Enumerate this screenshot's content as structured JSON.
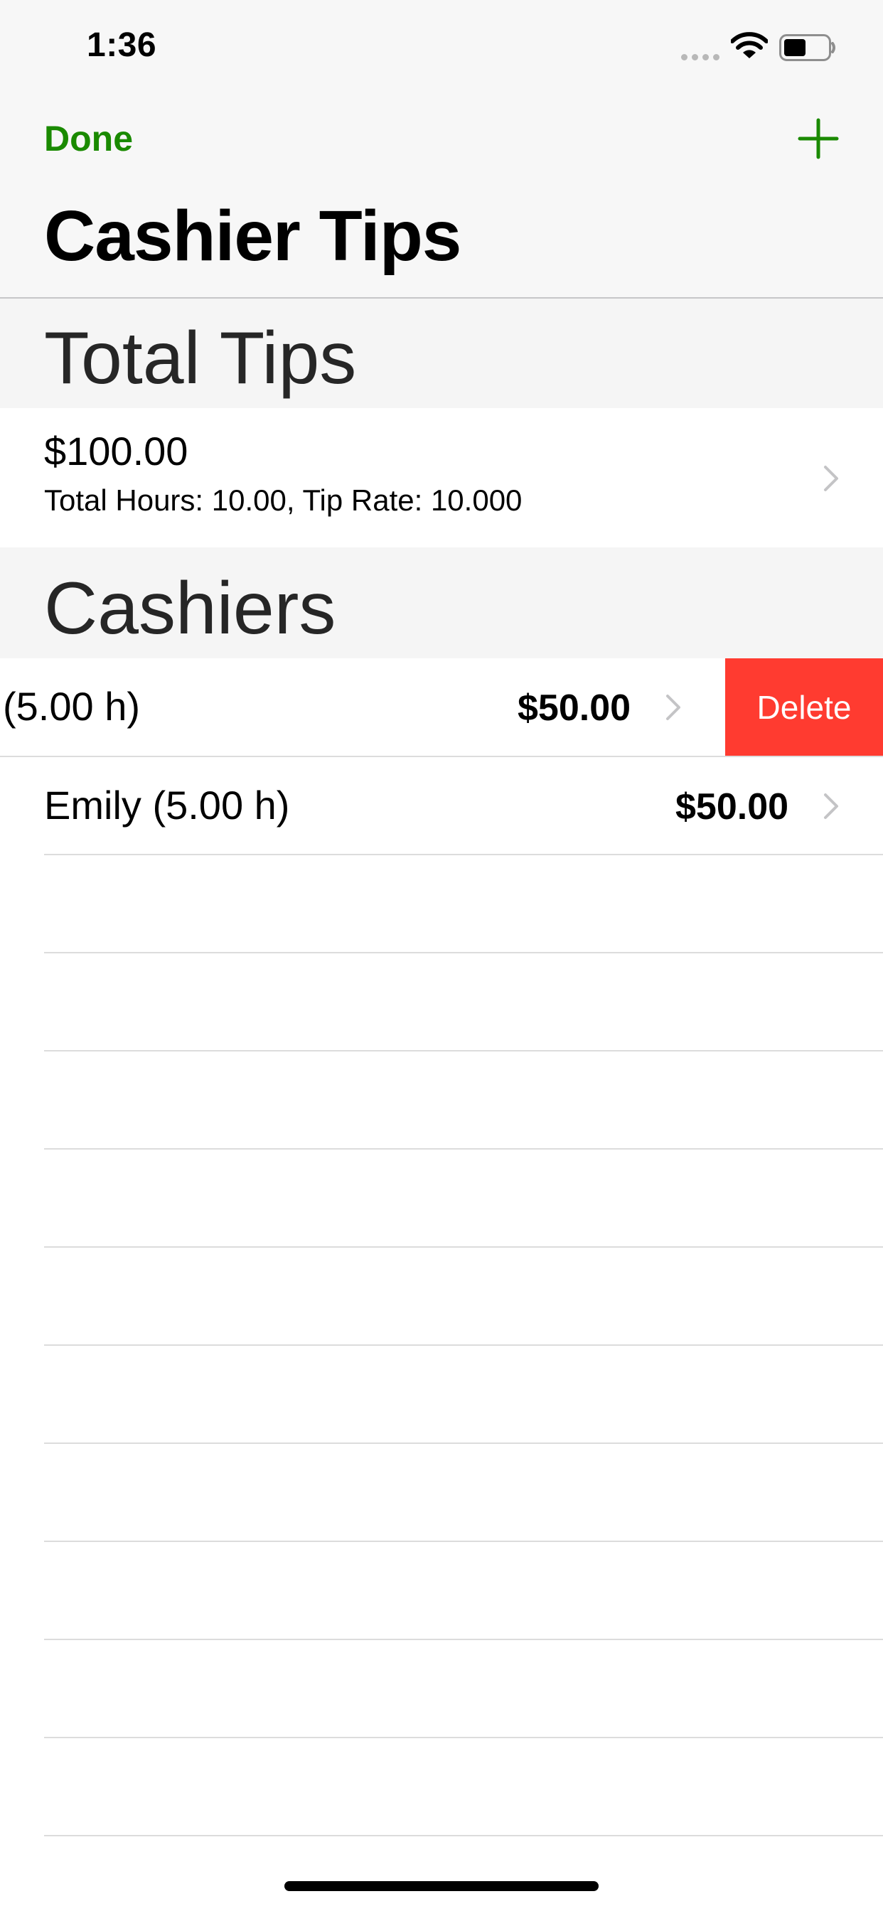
{
  "status_bar": {
    "time": "1:36"
  },
  "nav": {
    "done_label": "Done",
    "add_icon": "plus-icon",
    "title": "Cashier Tips"
  },
  "sections": {
    "total_header": "Total Tips",
    "cashiers_header": "Cashiers"
  },
  "total": {
    "amount": "$100.00",
    "detail": "Total Hours: 10.00, Tip Rate: 10.000"
  },
  "cashiers": [
    {
      "name": "(5.00 h)",
      "amount": "$50.00",
      "swiped": true
    },
    {
      "name": "Emily (5.00 h)",
      "amount": "$50.00",
      "swiped": false
    }
  ],
  "row_actions": {
    "delete_label": "Delete"
  },
  "colors": {
    "accent": "#1a8a00",
    "destructive": "#ff3b30"
  }
}
